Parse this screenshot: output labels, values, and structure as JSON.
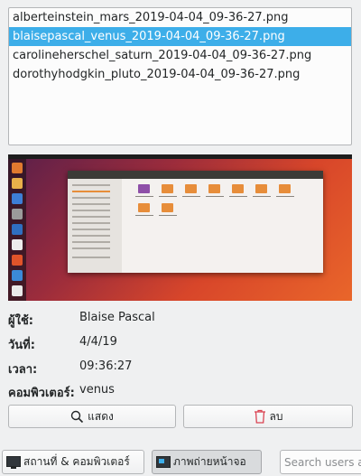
{
  "files": [
    "alberteinstein_mars_2019-04-04_09-36-27.png",
    "blaisepascal_venus_2019-04-04_09-36-27.png",
    "carolineherschel_saturn_2019-04-04_09-36-27.png",
    "dorothyhodgkin_pluto_2019-04-04_09-36-27.png"
  ],
  "selected_index": 1,
  "info": {
    "user_label": "ผู้ใช้:",
    "user_value": "Blaise Pascal",
    "date_label": "วันที่:",
    "date_value": "4/4/19",
    "time_label": "เวลา:",
    "time_value": "09:36:27",
    "computer_label": "คอมพิวเตอร์:",
    "computer_value": "venus"
  },
  "actions": {
    "show_label": "แสดง",
    "delete_label": "ลบ"
  },
  "bottom": {
    "places_label": "สถานที่ & คอมพิวเตอร์",
    "screenshots_label": "ภาพถ่ายหน้าจอ",
    "search_placeholder": "Search users a"
  },
  "icons": {
    "show": "magnifier-icon",
    "delete": "trash-icon",
    "places": "monitor-icon",
    "screenshots": "screenshot-icon"
  },
  "colors": {
    "selection": "#3daee9",
    "delete_icon": "#da4453"
  }
}
